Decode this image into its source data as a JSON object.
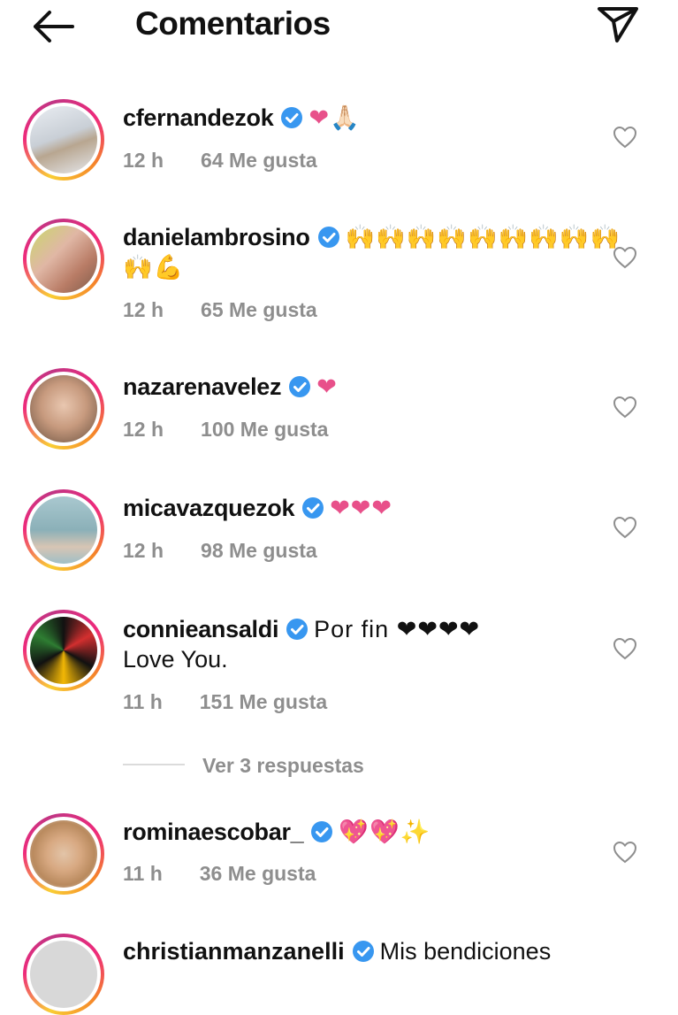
{
  "header": {
    "title": "Comentarios"
  },
  "comments": [
    {
      "username": "cfernandezok",
      "text": "❤🙏🏻",
      "time": "12 h",
      "likes": "64 Me gusta"
    },
    {
      "username": "danielambrosino",
      "text": "🙌🙌🙌🙌🙌🙌🙌🙌🙌",
      "text2": "🙌💪",
      "time": "12 h",
      "likes": "65 Me gusta"
    },
    {
      "username": "nazarenavelez",
      "text": "❤",
      "time": "12 h",
      "likes": "100 Me gusta"
    },
    {
      "username": "micavazquezok",
      "text": "❤❤❤",
      "time": "12 h",
      "likes": "98 Me gusta"
    },
    {
      "username": "connieansaldi",
      "text": "Por fin ❤❤❤❤",
      "text2": "Love You.",
      "time": "11 h",
      "likes": "151 Me gusta"
    },
    {
      "username": "rominaescobar_",
      "text": "💖💖✨",
      "time": "11 h",
      "likes": "36 Me gusta"
    }
  ],
  "replies": {
    "label": "Ver 3 respuestas"
  },
  "partial_comment": {
    "username": "christianmanzanelli",
    "text": "Mis bendiciones"
  },
  "colors": {
    "heart": "#e8508a",
    "verified": "#3897f0",
    "muted": "#8e8e8e"
  }
}
